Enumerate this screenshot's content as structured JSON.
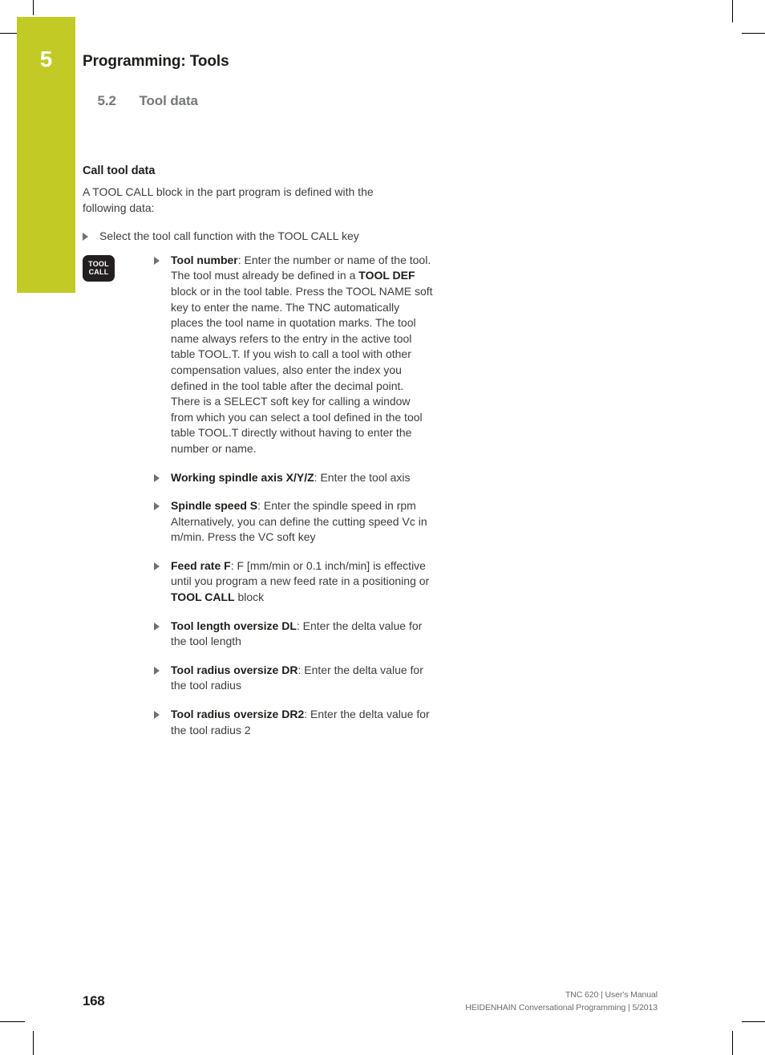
{
  "header": {
    "chapter_number": "5",
    "title": "Programming: Tools",
    "section_number": "5.2",
    "section_title": "Tool data"
  },
  "content": {
    "heading": "Call tool data",
    "intro": "A TOOL CALL block in the part program is defined with the following data:",
    "level1": [
      {
        "text": "Select the tool call function with the TOOL CALL key"
      }
    ],
    "softkey": {
      "line1": "TOOL",
      "line2": "CALL",
      "name": "tool-call-key"
    },
    "level2": [
      {
        "segments": [
          {
            "t": "Tool number",
            "b": true
          },
          {
            "t": ": Enter the number or name of the tool. The tool must already be defined in a ",
            "b": false
          },
          {
            "t": "TOOL DEF",
            "b": true
          },
          {
            "t": " block or in the tool table. Press the TOOL NAME soft key to enter the name. The TNC automatically places the tool name in quotation marks. The tool name always refers to the entry in the active tool table TOOL.T. If you wish to call a tool with other compensation values, also enter the index you defined in the tool table after the decimal point. There is a SELECT soft key for calling a window from which you can select a tool defined in the tool table TOOL.T directly without having to enter the number or name.",
            "b": false
          }
        ]
      },
      {
        "segments": [
          {
            "t": "Working spindle axis X/Y/Z",
            "b": true
          },
          {
            "t": ": Enter the tool axis",
            "b": false
          }
        ]
      },
      {
        "segments": [
          {
            "t": "Spindle speed S",
            "b": true
          },
          {
            "t": ": Enter the spindle speed in rpm Alternatively, you can define the cutting speed Vc in m/min. Press the VC soft key",
            "b": false
          }
        ]
      },
      {
        "segments": [
          {
            "t": "Feed rate F",
            "b": true
          },
          {
            "t": ": F [mm/min or 0.1 inch/min] is effective until you program a new feed rate in a positioning or ",
            "b": false
          },
          {
            "t": "TOOL CALL",
            "b": true
          },
          {
            "t": " block",
            "b": false
          }
        ]
      },
      {
        "segments": [
          {
            "t": "Tool length oversize DL",
            "b": true
          },
          {
            "t": ": Enter the delta value for the tool length",
            "b": false
          }
        ]
      },
      {
        "segments": [
          {
            "t": "Tool radius oversize DR",
            "b": true
          },
          {
            "t": ": Enter the delta value for the tool radius",
            "b": false
          }
        ]
      },
      {
        "segments": [
          {
            "t": "Tool radius oversize DR2",
            "b": true
          },
          {
            "t": ": Enter the delta value for the tool radius 2",
            "b": false
          }
        ]
      }
    ]
  },
  "footer": {
    "page_number": "168",
    "line1": "TNC 620 | User's Manual",
    "line2": "HEIDENHAIN Conversational Programming | 5/2013"
  },
  "colors": {
    "chapter_tab": "#c2cb26",
    "heading_text": "#1d1d1b",
    "body_text": "#3c3c3b",
    "subheader_text": "#76787a",
    "softkey_background": "#231f20"
  }
}
